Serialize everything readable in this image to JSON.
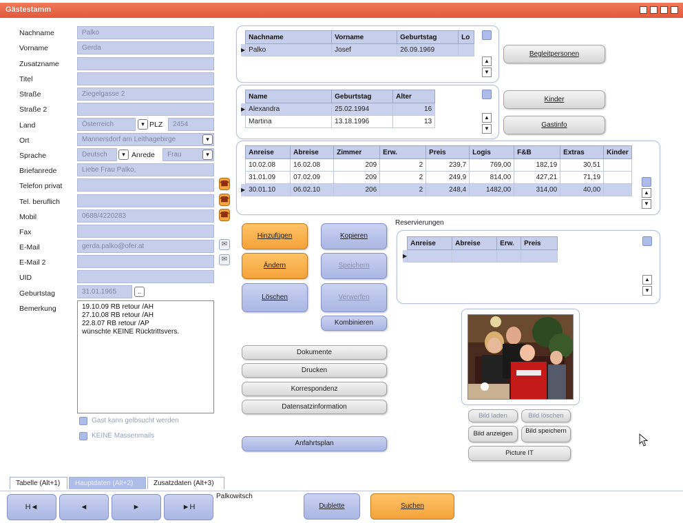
{
  "window": {
    "title": "Gästestamm"
  },
  "form": {
    "nachname": {
      "label": "Nachname",
      "value": "Palko"
    },
    "vorname": {
      "label": "Vorname",
      "value": "Gerda"
    },
    "zusatzname": {
      "label": "Zusatzname",
      "value": ""
    },
    "titel": {
      "label": "Titel",
      "value": ""
    },
    "strasse": {
      "label": "Straße",
      "value": "Ziegelgasse 2"
    },
    "strasse2": {
      "label": "Straße 2",
      "value": ""
    },
    "land": {
      "label": "Land",
      "value": "Österreich"
    },
    "plz": {
      "label": "PLZ",
      "value": "2454"
    },
    "ort": {
      "label": "Ort",
      "value": "Mannersdorf am Leithagebirge"
    },
    "sprache": {
      "label": "Sprache",
      "value": "Deutsch"
    },
    "anrede": {
      "label": "Anrede",
      "value": "Frau"
    },
    "briefanrede": {
      "label": "Briefanrede",
      "value": "Liebe Frau Palko,"
    },
    "telefon_privat": {
      "label": "Telefon privat",
      "value": ""
    },
    "tel_beruflich": {
      "label": "Tel. beruflich",
      "value": ""
    },
    "mobil": {
      "label": "Mobil",
      "value": "0688/4220283"
    },
    "fax": {
      "label": "Fax",
      "value": ""
    },
    "email": {
      "label": "E-Mail",
      "value": "gerda.palko@ofer.at"
    },
    "email2": {
      "label": "E-Mail 2",
      "value": ""
    },
    "uid": {
      "label": "UID",
      "value": ""
    },
    "geburtstag": {
      "label": "Geburtstag",
      "value": "31.01.1965"
    },
    "bemerkung": {
      "label": "Bemerkung",
      "lines": [
        "19.10.09 RB retour /AH",
        "27.10.08 RB retour /AH",
        "22.8.07 RB retour /AP",
        "wünschte KEINE Rücktrittsvers."
      ]
    },
    "checkbox_gelbsucht": "Gast kann gelbsucht werden",
    "checkbox_massenmails": "KEINE Massenmails"
  },
  "partner_table": {
    "columns": [
      "Nachname",
      "Vorname",
      "Geburtstag",
      "Lo"
    ],
    "rows": [
      [
        "Palko",
        "Josef",
        "26.09.1969",
        ""
      ]
    ]
  },
  "kinder_table": {
    "columns": [
      "Name",
      "Geburtstag",
      "Alter"
    ],
    "rows": [
      [
        "Alexandra",
        "25.02.1994",
        "16"
      ],
      [
        "Martina",
        "13.18.1996",
        "13"
      ]
    ]
  },
  "stays_table": {
    "columns": [
      "Anreise",
      "Abreise",
      "Zimmer",
      "Erw.",
      "Preis",
      "Logis",
      "F&B",
      "Extras",
      "Kinder"
    ],
    "rows": [
      [
        "10.02.08",
        "16.02.08",
        "209",
        "2",
        "239,7",
        "769,00",
        "182,19",
        "30,51",
        ""
      ],
      [
        "31.01.09",
        "07.02.09",
        "209",
        "2",
        "249,9",
        "814,00",
        "427,21",
        "71,19",
        ""
      ],
      [
        "30.01.10",
        "06.02.10",
        "206",
        "2",
        "248,4",
        "1482,00",
        "314,00",
        "40,00",
        ""
      ]
    ]
  },
  "reservations": {
    "title": "Reservierungen",
    "columns": [
      "Anreise",
      "Abreise",
      "Erw.",
      "Preis"
    ]
  },
  "buttons": {
    "begleitpersonen": "Begleitpersonen",
    "kinder": "Kinder",
    "gastinfo": "Gastinfo",
    "hinzufuegen": "Hinzufügen",
    "kopieren": "Kopieren",
    "aendern": "Ändern",
    "speichern": "Speichern",
    "loeschen": "Löschen",
    "verwerfen": "Verwerfen",
    "kombinieren": "Kombinieren",
    "dokumente": "Dokumente",
    "drucken": "Drucken",
    "korrespondenz": "Korrespondenz",
    "datensatzinformation": "Datensatzinformation",
    "anfahrtsplan": "Anfahrtsplan",
    "bild_laden": "Bild laden",
    "bild_loeschen": "Bild löschen",
    "bild_anzeigen": "Bild anzeigen",
    "bild_speichern": "Bild speichern",
    "picture_it": "Picture IT"
  },
  "tabs": [
    "Tabelle (Alt+1)",
    "Hauptdaten (Alt+2)",
    "Zusatzdaten (Alt+3)"
  ],
  "navbar": {
    "first": "H◄",
    "prev": "◄",
    "next": "►",
    "last": "►H",
    "search_text": "Palkowitsch",
    "dublette": "Dublette",
    "suchen": "Suchen"
  },
  "colors": {
    "titlebar": "#e2593a",
    "field": "#c5ceea",
    "orange": "#f3a33a",
    "blue_button": "#aab6e4"
  },
  "icons": [
    "phone-icon",
    "mail-icon",
    "record-pointer-icon",
    "mouse-cursor-icon",
    "dropdown-arrow-icon"
  ]
}
